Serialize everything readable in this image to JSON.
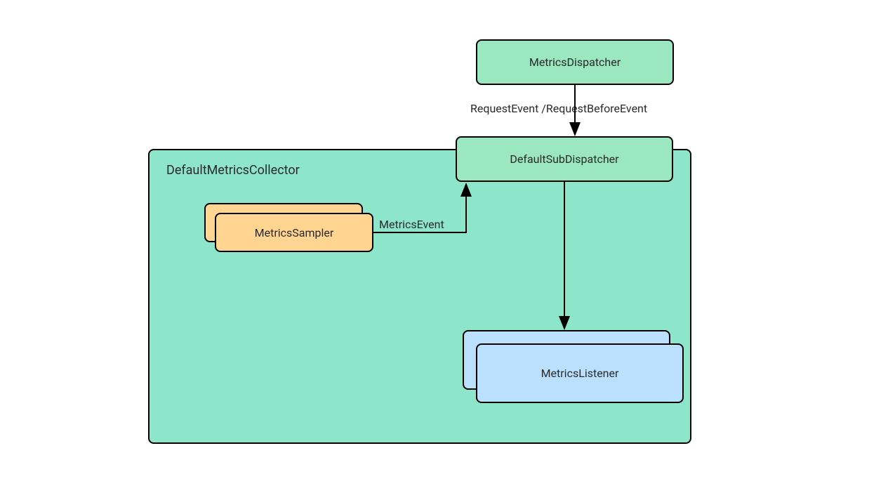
{
  "nodes": {
    "metricsDispatcher": "MetricsDispatcher",
    "defaultSubDispatcher": "DefaultSubDispatcher",
    "defaultMetricsCollector": "DefaultMetricsCollector",
    "metricsSampler": "MetricsSampler",
    "metricsListener": "MetricsListener"
  },
  "edges": {
    "requestEvent": "RequestEvent /RequestBeforeEvent",
    "metricsEvent": "MetricsEvent"
  },
  "colors": {
    "green": "#9be7bf",
    "orange": "#ffd591",
    "blue": "#bae0fd",
    "teal": "#8de6ca",
    "border": "#000000",
    "text": "#2a2a2a"
  }
}
